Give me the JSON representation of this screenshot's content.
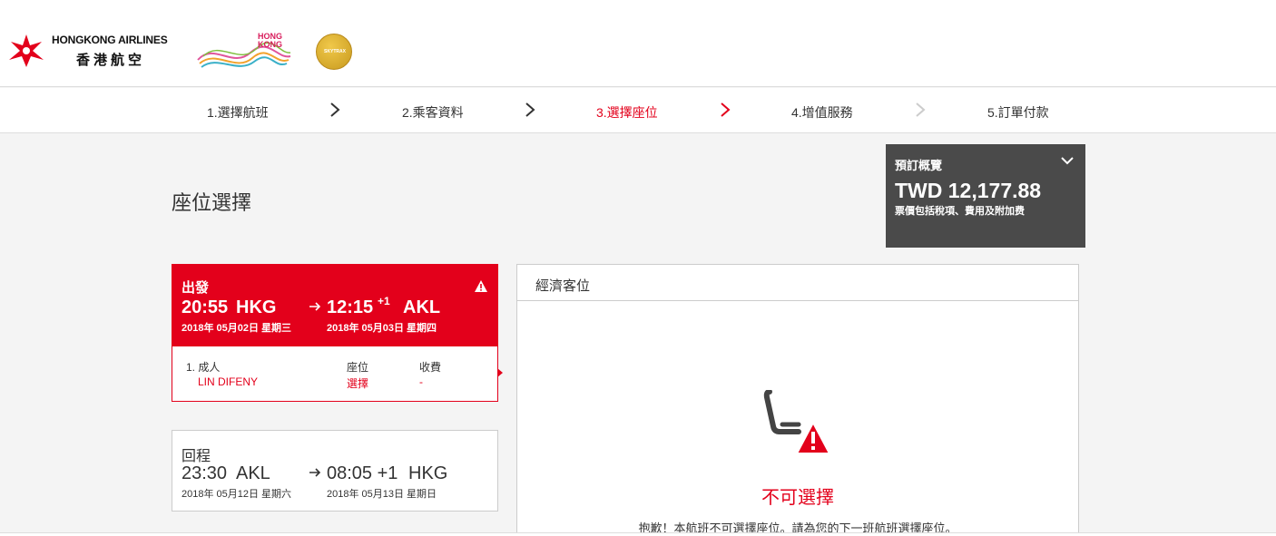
{
  "header": {
    "airline_name_en": "HONGKONG AIRLINES",
    "airline_name_zh": "香港航空",
    "brand_hk_text": "HONG\nKONG",
    "award_text": "SKYTRAX"
  },
  "steps": [
    {
      "label": "1.選擇航班"
    },
    {
      "label": "2.乘客資料"
    },
    {
      "label": "3.選擇座位"
    },
    {
      "label": "4.增值服務"
    },
    {
      "label": "5.訂單付款"
    }
  ],
  "page_title": "座位選擇",
  "summary": {
    "label": "預訂概覽",
    "price": "TWD 12,177.88",
    "note": "票價包括稅項、費用及附加费"
  },
  "outbound": {
    "label": "出發",
    "dep_time": "20:55",
    "dep_airport": "HKG",
    "arr_time": "12:15",
    "arr_offset": "+1",
    "arr_airport": "AKL",
    "dep_date": "2018年 05月02日 星期三",
    "arr_date": "2018年 05月03日 星期四",
    "passenger_index": "1. 成人",
    "passenger_name": "LIN DIFENY",
    "seat_header": "座位",
    "seat_value": "選擇",
    "fee_header": "收費",
    "fee_value": "-"
  },
  "return": {
    "label": "回程",
    "dep_time": "23:30",
    "dep_airport": "AKL",
    "arr_time": "08:05 +1",
    "arr_airport": "HKG",
    "dep_date": "2018年 05月12日 星期六",
    "arr_date": "2018年 05月13日 星期日"
  },
  "seat_panel": {
    "title": "經濟客位",
    "status": "不可選擇",
    "message": "抱歉！本航班不可選擇座位。請為您的下一班航班選擇座位。"
  },
  "colors": {
    "brand_red": "#e3001b",
    "summary_bg": "#4a4a4a"
  }
}
